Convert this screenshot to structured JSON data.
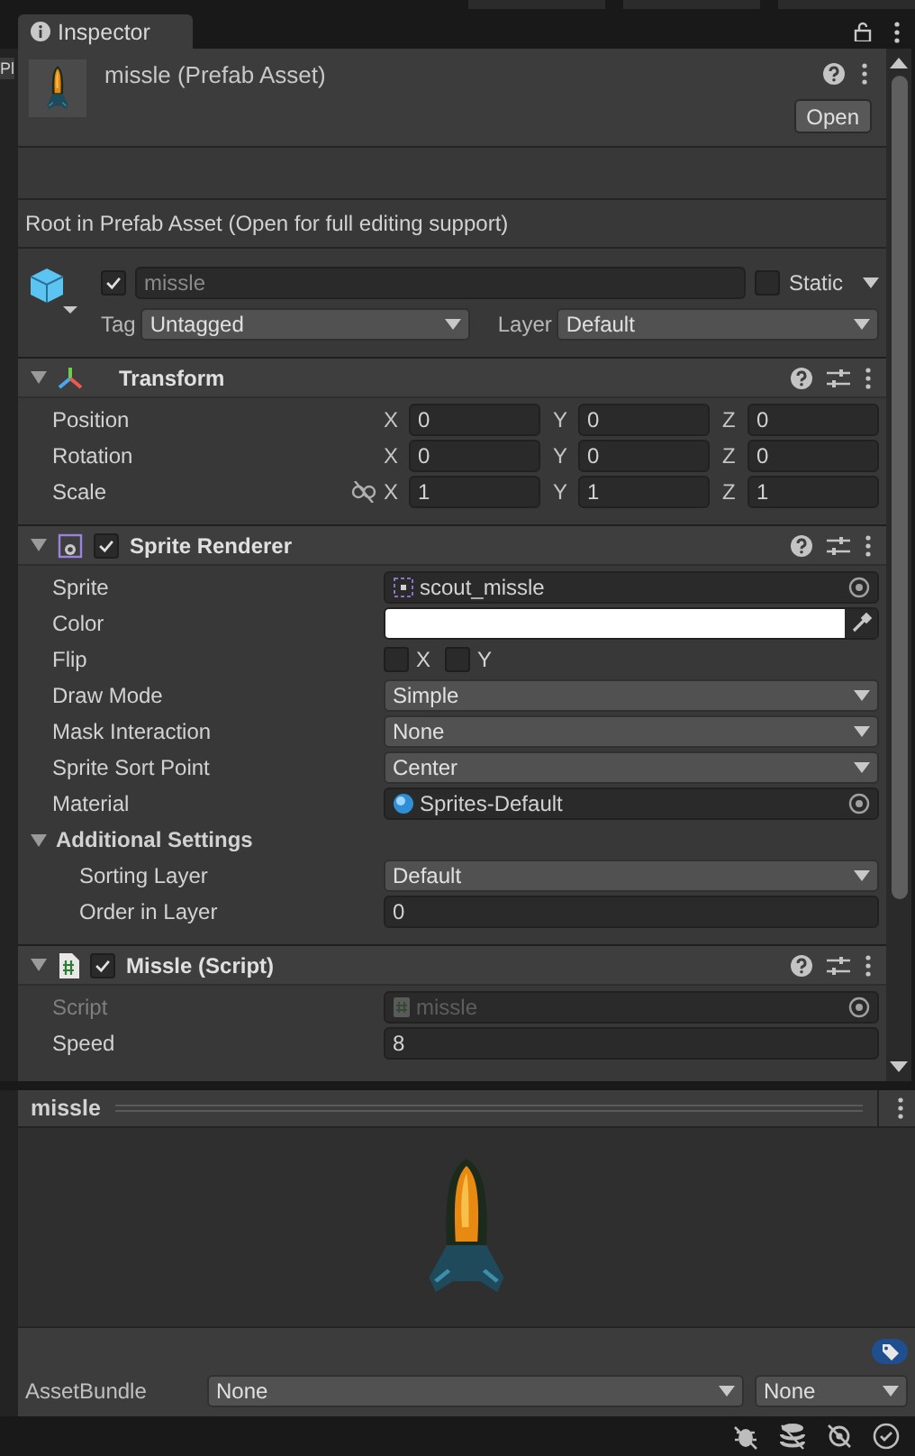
{
  "side_tab": "Pl",
  "tab": {
    "title": "Inspector"
  },
  "header": {
    "title": "missle (Prefab Asset)",
    "open_button": "Open"
  },
  "notice": "Root in Prefab Asset (Open for full editing support)",
  "game_object": {
    "active": true,
    "name": "missle",
    "static": false,
    "static_label": "Static",
    "tag_label": "Tag",
    "tag": "Untagged",
    "layer_label": "Layer",
    "layer": "Default"
  },
  "components": [
    {
      "kind": "transform",
      "title": "Transform",
      "expanded": true,
      "rows": [
        {
          "kind": "vector",
          "label": "Position",
          "fields": [
            {
              "axis": "X",
              "value": "0"
            },
            {
              "axis": "Y",
              "value": "0"
            },
            {
              "axis": "Z",
              "value": "0"
            }
          ]
        },
        {
          "kind": "vector",
          "label": "Rotation",
          "fields": [
            {
              "axis": "X",
              "value": "0"
            },
            {
              "axis": "Y",
              "value": "0"
            },
            {
              "axis": "Z",
              "value": "0"
            }
          ]
        },
        {
          "kind": "vector",
          "label": "Scale",
          "constrained": false,
          "fields": [
            {
              "axis": "X",
              "value": "1"
            },
            {
              "axis": "Y",
              "value": "1"
            },
            {
              "axis": "Z",
              "value": "1"
            }
          ]
        }
      ]
    },
    {
      "kind": "sprite_renderer",
      "title": "Sprite Renderer",
      "enabled": true,
      "expanded": true,
      "rows": [
        {
          "kind": "sprite_field",
          "label": "Sprite",
          "value": "scout_missle"
        },
        {
          "kind": "color",
          "label": "Color",
          "color": "#ffffff"
        },
        {
          "kind": "flip",
          "label": "Flip",
          "options": [
            {
              "label": "X",
              "checked": false
            },
            {
              "label": "Y",
              "checked": false
            }
          ]
        },
        {
          "kind": "dropdown",
          "label": "Draw Mode",
          "value": "Simple"
        },
        {
          "kind": "dropdown",
          "label": "Mask Interaction",
          "value": "None"
        },
        {
          "kind": "dropdown",
          "label": "Sprite Sort Point",
          "value": "Center"
        },
        {
          "kind": "material_field",
          "label": "Material",
          "value": "Sprites-Default"
        },
        {
          "kind": "foldout",
          "label": "Additional Settings",
          "expanded": true,
          "children": [
            {
              "kind": "dropdown",
              "label": "Sorting Layer",
              "value": "Default"
            },
            {
              "kind": "number",
              "label": "Order in Layer",
              "value": "0"
            }
          ]
        }
      ]
    },
    {
      "kind": "script",
      "title": "Missle (Script)",
      "enabled": true,
      "expanded": true,
      "rows": [
        {
          "kind": "script_field",
          "label": "Script",
          "value": "missle",
          "disabled": true
        },
        {
          "kind": "number",
          "label": "Speed",
          "value": "8"
        }
      ]
    }
  ],
  "preview": {
    "title": "missle"
  },
  "asset_bundle": {
    "label": "AssetBundle",
    "bundle": "None",
    "variant": "None"
  }
}
